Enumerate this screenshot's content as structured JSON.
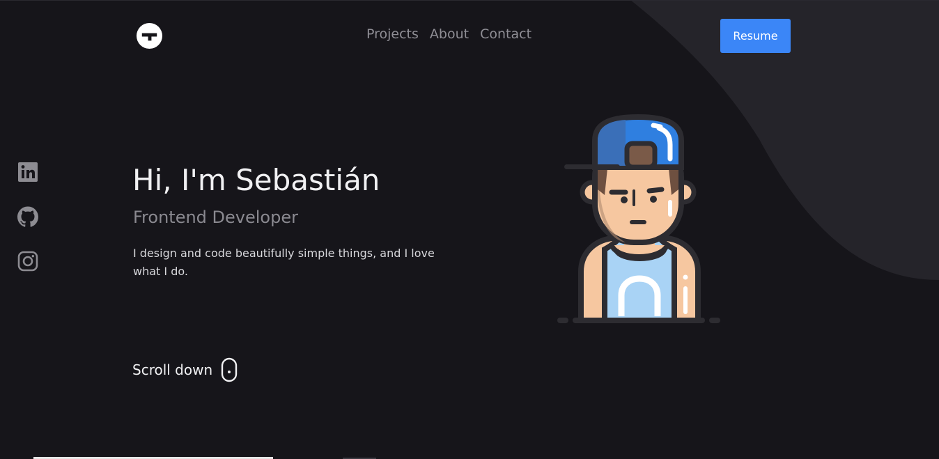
{
  "header": {
    "logo_icon": "g-logo-icon",
    "nav": [
      {
        "label": "Projects"
      },
      {
        "label": "About"
      },
      {
        "label": "Contact"
      }
    ],
    "resume_label": "Resume"
  },
  "social": {
    "items": [
      {
        "icon": "linkedin-icon"
      },
      {
        "icon": "github-icon"
      },
      {
        "icon": "instagram-icon"
      }
    ]
  },
  "hero": {
    "title": "Hi, I'm Sebastián",
    "subtitle": "Frontend Developer",
    "description": "I design and code beautifully simple things, and I love what I do.",
    "scroll_label": "Scroll down",
    "scroll_icon": "mouse-icon",
    "avatar_icon": "avatar-illustration"
  },
  "colors": {
    "background": "#16151a",
    "accent": "#3b86f7",
    "shape": "#25242a",
    "muted_text": "#8f8e95"
  }
}
